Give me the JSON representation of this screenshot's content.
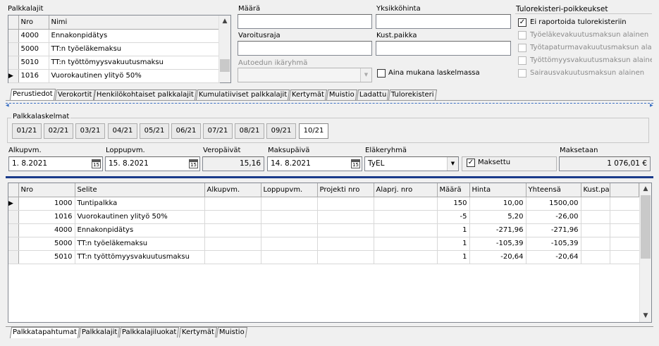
{
  "top_grid": {
    "title": "Palkkalajit",
    "columns": [
      "Nro",
      "Nimi"
    ],
    "rows": [
      {
        "nro": "4000",
        "nimi": "Ennakonpidätys"
      },
      {
        "nro": "5000",
        "nimi": "TT:n työeläkemaksu"
      },
      {
        "nro": "5010",
        "nimi": "TT:n työttömyysvakuutusmaksu"
      },
      {
        "nro": "1016",
        "nimi": "Vuorokautinen ylityö 50%"
      }
    ]
  },
  "fields": {
    "maara_label": "Määrä",
    "maara_value": "",
    "yksikkohinta_label": "Yksikköhinta",
    "yksikkohinta_value": "",
    "varoitusraja_label": "Varoitusraja",
    "varoitusraja_value": "",
    "kustpaikka_label": "Kust.paikka",
    "kustpaikka_value": "",
    "autoedun_label": "Autoedun ikäryhmä",
    "autoedun_value": "",
    "aina_mukana_label": "Aina mukana laskelmassa"
  },
  "tulorekisteri": {
    "title": "Tulorekisteri-poikkeukset",
    "items": [
      {
        "label": "Ei raportoida tulorekisteriin",
        "checked": true,
        "enabled": true
      },
      {
        "label": "Työeläkevakuutusmaksun alainen",
        "checked": false,
        "enabled": false
      },
      {
        "label": "Työtapaturmavakuutusmaksun alainen",
        "checked": false,
        "enabled": false
      },
      {
        "label": "Työttömyysvakuutusmaksun alainen",
        "checked": false,
        "enabled": false
      },
      {
        "label": "Sairausvakuutusmaksun alainen",
        "checked": false,
        "enabled": false
      }
    ]
  },
  "tabs_top": [
    "Perustiedot",
    "Verokortit",
    "Henkilökohtaiset palkkalajit",
    "Kumulatiiviset palkkalajit",
    "Kertymät",
    "Muistio",
    "Ladattu",
    "Tulorekisteri"
  ],
  "palkkalaskelmat": {
    "title": "Palkkalaskelmat",
    "months": [
      "01/21",
      "02/21",
      "03/21",
      "04/21",
      "05/21",
      "06/21",
      "07/21",
      "08/21",
      "09/21",
      "10/21"
    ]
  },
  "period": {
    "alkupvm_label": "Alkupvm.",
    "alkupvm": "1. 8.2021",
    "loppupvm_label": "Loppupvm.",
    "loppupvm": "15. 8.2021",
    "veropaivat_label": "Veropäivät",
    "veropaivat": "15,16",
    "maksupaiva_label": "Maksupäivä",
    "maksupaiva": "14. 8.2021",
    "elakeryhma_label": "Eläkeryhmä",
    "elakeryhma": "TyEL",
    "maksettu_label": "Maksettu",
    "maksetaan_label": "Maksetaan",
    "maksetaan": "1 076,01 €",
    "cal_glyph": "15"
  },
  "main_grid": {
    "columns": [
      "Nro",
      "Selite",
      "Alkupvm.",
      "Loppupvm.",
      "Projekti nro",
      "Alaprj. nro",
      "Määrä",
      "Hinta",
      "Yhteensä",
      "Kust.paikka"
    ],
    "rows": [
      {
        "nro": "1000",
        "selite": "Tuntipalkka",
        "alku": "",
        "loppu": "",
        "projekti": "",
        "alaprj": "",
        "maara": "150",
        "hinta": "10,00",
        "yhteensa": "1500,00",
        "kust": ""
      },
      {
        "nro": "1016",
        "selite": "Vuorokautinen ylityö 50%",
        "alku": "",
        "loppu": "",
        "projekti": "",
        "alaprj": "",
        "maara": "-5",
        "hinta": "5,20",
        "yhteensa": "-26,00",
        "kust": ""
      },
      {
        "nro": "4000",
        "selite": "Ennakonpidätys",
        "alku": "",
        "loppu": "",
        "projekti": "",
        "alaprj": "",
        "maara": "1",
        "hinta": "-271,96",
        "yhteensa": "-271,96",
        "kust": ""
      },
      {
        "nro": "5000",
        "selite": "TT:n työeläkemaksu",
        "alku": "",
        "loppu": "",
        "projekti": "",
        "alaprj": "",
        "maara": "1",
        "hinta": "-105,39",
        "yhteensa": "-105,39",
        "kust": ""
      },
      {
        "nro": "5010",
        "selite": "TT:n työttömyysvakuutusmaksu",
        "alku": "",
        "loppu": "",
        "projekti": "",
        "alaprj": "",
        "maara": "1",
        "hinta": "-20,64",
        "yhteensa": "-20,64",
        "kust": ""
      }
    ]
  },
  "tabs_bottom": [
    "Palkkatapahtumat",
    "Palkkalajit",
    "Palkkalajiluokat",
    "Kertymät",
    "Muistio"
  ],
  "colors": {
    "separator": "#1a3a8a",
    "window_bg": "#f0f0f0"
  }
}
